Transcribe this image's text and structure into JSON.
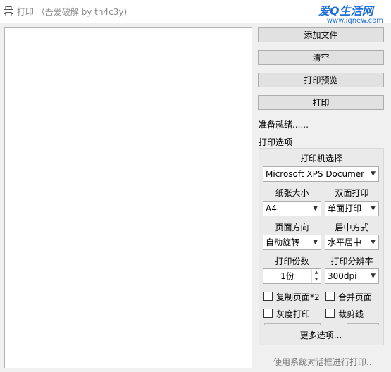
{
  "window": {
    "title": "打印 （吾爱破解 by th4c3y)",
    "minimize": "—",
    "logo_main": "爱Q生活网",
    "logo_url": "www.iqnew.com"
  },
  "buttons": {
    "add_file": "添加文件",
    "clear": "清空",
    "preview": "打印预览",
    "print": "打印"
  },
  "status": "准备就绪......",
  "options": {
    "section_label": "打印选项",
    "printer_label": "打印机选择",
    "printer_value": "Microsoft XPS Documer",
    "paper_label": "纸张大小",
    "paper_value": "A4",
    "duplex_label": "双面打印",
    "duplex_value": "单面打印",
    "orientation_label": "页面方向",
    "orientation_value": "自动旋转",
    "center_label": "居中方式",
    "center_value": "水平居中",
    "copies_label": "打印份数",
    "copies_value": "1份",
    "resolution_label": "打印分辨率",
    "resolution_value": "300dpi",
    "copy_pages_label": "复制页面*2",
    "merge_pages_label": "合并页面",
    "grayscale_label": "灰度打印",
    "crop_marks_label": "裁剪线",
    "more_options": "更多选项..."
  },
  "system_dialog_link": "使用系统对话框进行打印.."
}
